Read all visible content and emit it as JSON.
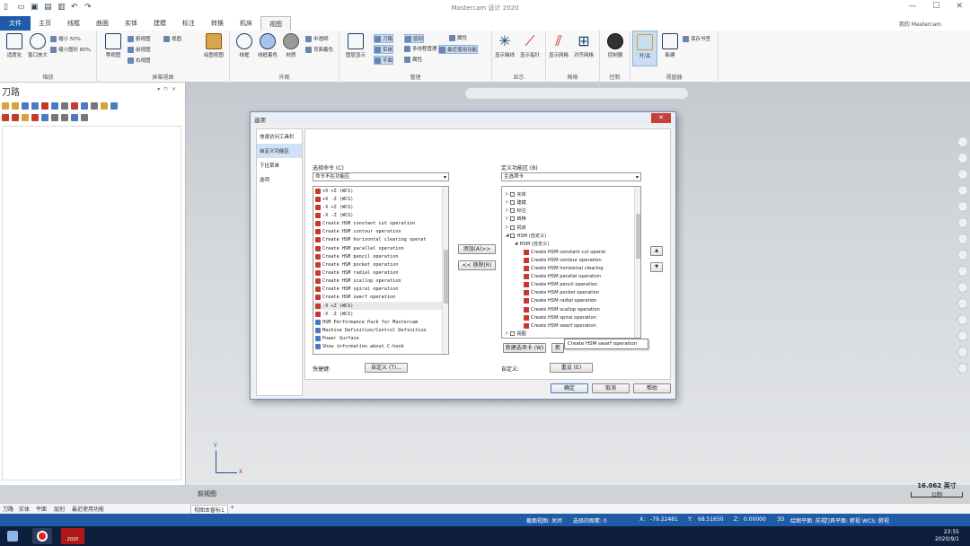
{
  "app": {
    "title": "Mastercam 设计 2020",
    "my_mastercam": "我的 Mastercam",
    "window_controls": [
      "—",
      "☐",
      "✕"
    ]
  },
  "tabs": [
    "文件",
    "主页",
    "线框",
    "曲面",
    "实体",
    "建模",
    "标注",
    "转换",
    "机床",
    "视图"
  ],
  "ribbon": {
    "groups": [
      {
        "label": "缩放"
      },
      {
        "label": "屏幕视图"
      },
      {
        "label": "外观"
      },
      {
        "label": "管理"
      },
      {
        "label": "显示"
      },
      {
        "label": "网格"
      },
      {
        "label": "控制"
      },
      {
        "label": "视窗器"
      }
    ],
    "zoom": {
      "fit": "适度化",
      "window_zoom": "窗口放大",
      "zoom_50": "缩小 50%",
      "zoom_80": "缩小图形 80%"
    },
    "screen_view": {
      "iso": "等视图",
      "top": "俯视图",
      "front": "前视图",
      "right": "右视图",
      "saved": "视图",
      "other": "绘图视图"
    },
    "appearance": {
      "wire": "线框",
      "shaded": "线框着色",
      "material": "材质",
      "semi": "半透明",
      "backside": "背面着色"
    },
    "manage": {
      "display_ctrl": "图层显示",
      "toolpath": "刀路",
      "solid": "实体",
      "plane": "平面",
      "layer": "层别",
      "multi": "多线程管理",
      "recent": "最近使用功能",
      "attr": "属性"
    },
    "display": {
      "axes": "显示轴线",
      "gnomon": "显示指针"
    },
    "grid": {
      "show": "显示网格",
      "snap": "对齐网格"
    },
    "control": {
      "controller": "控制器"
    },
    "viewsheet": {
      "toggle": "开/关",
      "new": "新建",
      "save_marker": "保存书签"
    }
  },
  "left_panel": {
    "title": "刀路"
  },
  "viewport": {
    "view_label": "前视图",
    "axis_x": "X",
    "axis_y": "Y",
    "scale": "16.062 英寸",
    "scale_unit": "公制"
  },
  "bottom_tabs": [
    "刀路",
    "实体",
    "平面",
    "层别",
    "最近使用功能"
  ],
  "view_tab": "视图本窗标1",
  "status": {
    "section": "截面视图: 关闭",
    "selected": "选择的图素: 0",
    "x_label": "X:",
    "x_val": "-79.22481",
    "y_label": "Y:",
    "y_val": "68.51650",
    "z_label": "Z:",
    "z_val": "0.00000",
    "mode": "3D",
    "gview": "绘图平面: 前视",
    "tplane": "刀具平面: 俯视",
    "wcs": "WCS: 俯视"
  },
  "clock": {
    "time": "23:55",
    "date": "2020/9/1"
  },
  "taskbar": {
    "mastercam_badge": "2020"
  },
  "dialog": {
    "title": "选项",
    "close": "✕",
    "nav": [
      "快速访问工具栏",
      "自定义功能区",
      "下拉菜单",
      "选项"
    ],
    "nav_selected": 1,
    "choose_label": "选择命令 (C)",
    "choose_value": "命令不在功能区",
    "customize_label": "定义功能区 (B)",
    "customize_value": "主选项卡",
    "commands": [
      "+X +Z (WCS)",
      "+X -Z (WCS)",
      "-X +Z (WCS)",
      "-X -Z (WCS)",
      "Create HSM constant cut operation",
      "Create HSM contour operation",
      "Create HSM horizontal clearing operat",
      "Create HSM parallel operation",
      "Create HSM pencil operation",
      "Create HSM pocket operation",
      "Create HSM radial operation",
      "Create HSM scallop operation",
      "Create HSM spiral operation",
      "Create HSM swarf operation",
      "-X +Z (WCS)",
      "-X -Z (WCS)",
      "HSM Performance Pack for Mastercam",
      "Machine Definition/Control Definition",
      "Power Surface",
      "Show information about C-hook"
    ],
    "add_btn": "添加(A)>>",
    "remove_btn": "<< 移除(R)",
    "tree": [
      {
        "t": "实体",
        "lvl": 0
      },
      {
        "t": "建模",
        "lvl": 0
      },
      {
        "t": "标注",
        "lvl": 0
      },
      {
        "t": "转换",
        "lvl": 0
      },
      {
        "t": "机床",
        "lvl": 0
      },
      {
        "t": "HSM (自定义)",
        "lvl": 0
      },
      {
        "t": "HSM (自定义)",
        "lvl": 1
      },
      {
        "t": "Create HSM constant cut operat",
        "lvl": 2
      },
      {
        "t": "Create HSM contour operation",
        "lvl": 2
      },
      {
        "t": "Create HSM horizontal clearing",
        "lvl": 2
      },
      {
        "t": "Create HSM parallel operation",
        "lvl": 2
      },
      {
        "t": "Create HSM pencil operation",
        "lvl": 2
      },
      {
        "t": "Create HSM pocket operation",
        "lvl": 2
      },
      {
        "t": "Create HSM radial operation",
        "lvl": 2
      },
      {
        "t": "Create HSM scallop operation",
        "lvl": 2
      },
      {
        "t": "Create HSM spiral operation",
        "lvl": 2
      },
      {
        "t": "Create HSM swarf operation",
        "lvl": 2
      },
      {
        "t": "视图",
        "lvl": 0
      }
    ],
    "tooltip": "Create HSM swarf operation",
    "new_tab_btn": "新建选项卡 (W)",
    "new_group_btn": "新",
    "shortcut_label": "快捷键:",
    "shortcut_btn": "自定义 (T)...",
    "customize2_label": "自定义:",
    "reset_btn": "重设 (E)",
    "ok_btn": "确定",
    "cancel_btn": "取消",
    "help_btn": "帮助"
  }
}
